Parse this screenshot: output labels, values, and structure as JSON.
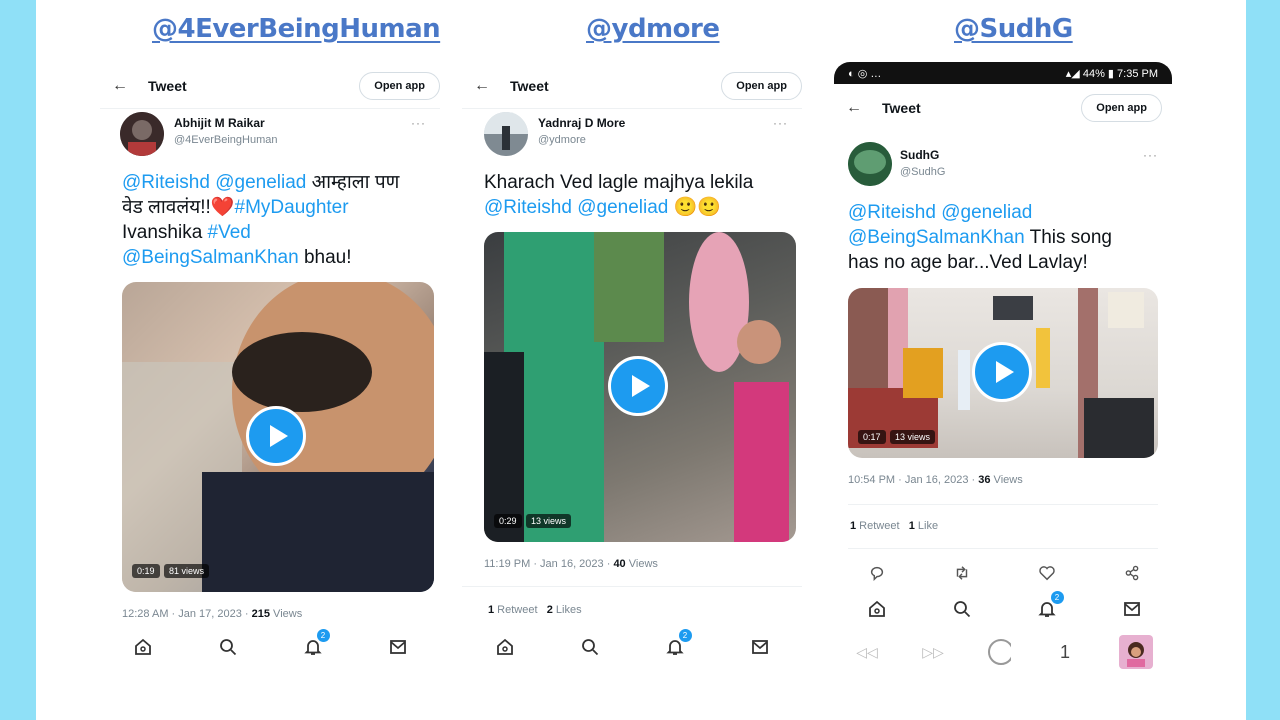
{
  "cards": [
    {
      "handle": "@4EverBeingHuman",
      "topbar_title": "Tweet",
      "open_app": "Open app",
      "author_name": "Abhijit M Raikar",
      "author_handle": "@4EverBeingHuman",
      "more": "···",
      "text_parts": [
        "@Riteishd",
        " ",
        "@geneliad",
        " आम्हाला पण",
        "वेड लावलंय!!",
        "❤️",
        "#MyDaughter",
        "Ivanshika ",
        "#Ved",
        "@BeingSalmanKhan",
        " bhau!"
      ],
      "video_time": "0:19",
      "video_views": "81 views",
      "timestamp": "12:28 AM · Jan 17, 2023 · ",
      "views_count": "215",
      "views_label": " Views",
      "notif_badge": "2"
    },
    {
      "handle": "@ydmore",
      "topbar_title": "Tweet",
      "open_app": "Open app",
      "author_name": "Yadnraj D More",
      "author_handle": "@ydmore",
      "more": "···",
      "text_line1": "Kharach Ved lagle majhya lekila",
      "text_parts": [
        "@Riteishd",
        " ",
        "@geneliad",
        " 🙂🙂"
      ],
      "video_time": "0:29",
      "video_views": "13 views",
      "timestamp": "11:19 PM · Jan 16, 2023 · ",
      "views_count": "40",
      "views_label": " Views",
      "retweets_count": "1",
      "retweets_label": " Retweet",
      "likes_count": "2",
      "likes_label": " Likes",
      "notif_badge": "2"
    },
    {
      "handle": "@SudhG",
      "status_time": "7:35 PM",
      "status_battery": "44%",
      "topbar_title": "Tweet",
      "open_app": "Open app",
      "author_name": "SudhG",
      "author_handle": "@SudhG",
      "more": "···",
      "text_parts": [
        "@Riteishd",
        " ",
        "@geneliad",
        "@BeingSalmanKhan",
        " This song",
        "has no age bar...Ved Lavlay!"
      ],
      "video_time": "0:17",
      "video_views": "13 views",
      "timestamp": "10:54 PM · Jan 16, 2023 · ",
      "views_count": "36",
      "views_label": " Views",
      "retweets_count": "1",
      "retweets_label": " Retweet",
      "likes_count": "1",
      "likes_label": " Like",
      "notif_badge": "2",
      "page_number": "1"
    }
  ],
  "colors": {
    "background": "#8fe0f7",
    "handle_link": "#4a78c7",
    "twitter_blue": "#1d9bf0"
  }
}
